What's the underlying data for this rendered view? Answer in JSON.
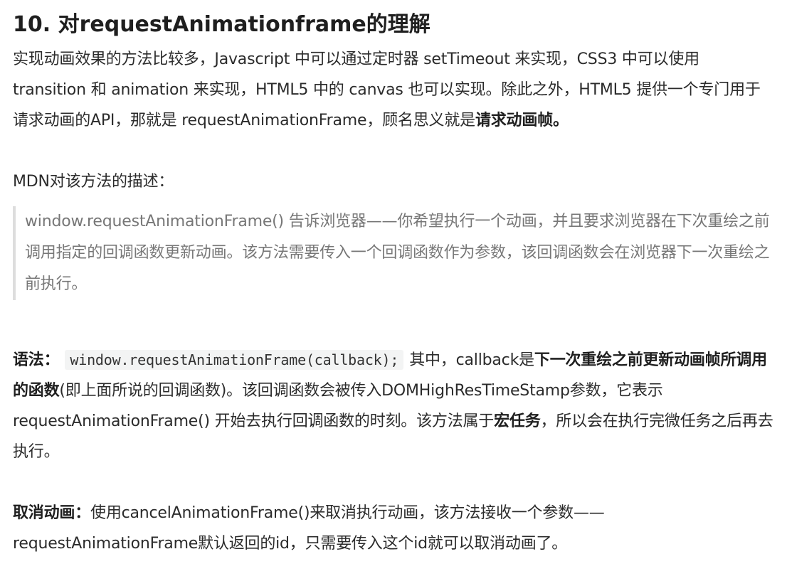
{
  "title": "10. 对requestAnimationframe的理解",
  "intro": {
    "text1": "实现动画效果的方法比较多，Javascript 中可以通过定时器 setTimeout 来实现，CSS3 中可以使用 transition 和 animation 来实现，HTML5 中的 canvas 也可以实现。除此之外，HTML5 提供一个专门用于请求动画的API，那就是 requestAnimationFrame，顾名思义就是",
    "bold": "请求动画帧。"
  },
  "mdn_label": "MDN对该方法的描述：",
  "quote": "window.requestAnimationFrame() 告诉浏览器——你希望执行一个动画，并且要求浏览器在下次重绘之前调用指定的回调函数更新动画。该方法需要传入一个回调函数作为参数，该回调函数会在浏览器下一次重绘之前执行。",
  "syntax": {
    "label": "语法：",
    "code": "window.requestAnimationFrame(callback);",
    "text1": "其中，callback是",
    "bold1": "下一次重绘之前更新动画帧所调用的函数",
    "text2": "(即上面所说的回调函数)。该回调函数会被传入DOMHighResTimeStamp参数，它表示requestAnimationFrame() 开始去执行回调函数的时刻。该方法属于",
    "bold2": "宏任务",
    "text3": "，所以会在执行完微任务之后再去执行。"
  },
  "cancel": {
    "label": "取消动画：",
    "text1": "使用cancelAnimationFrame()来取消执行动画，该方法接收一个参数——",
    "text2": "requestAnimationFrame默认返回的id，只需要传入这个id就可以取消动画了。"
  }
}
